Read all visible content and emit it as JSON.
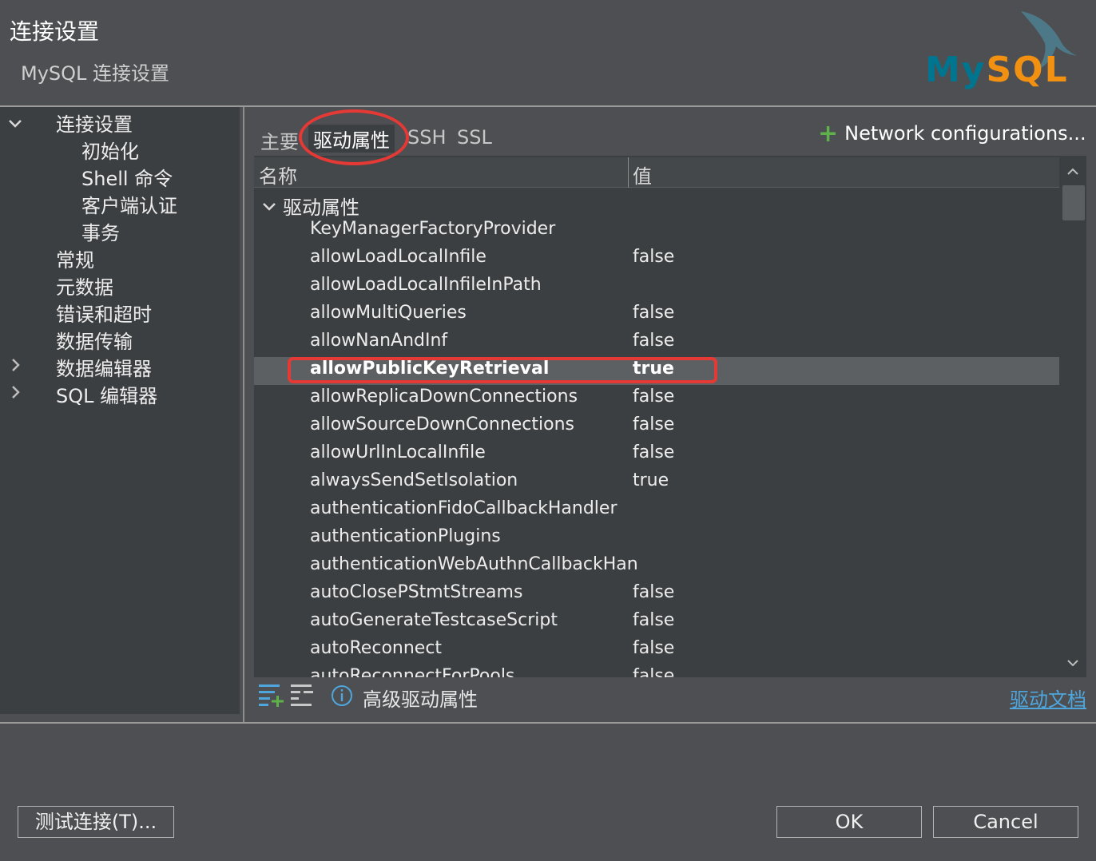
{
  "header": {
    "title": "连接设置",
    "subtitle": "MySQL 连接设置",
    "logo_part1": "My",
    "logo_part2": "SQL",
    "logo_icon": "mysql-dolphin-icon"
  },
  "sidebar": {
    "items": [
      {
        "label": "连接设置",
        "expanded": true
      },
      {
        "label": "初始化"
      },
      {
        "label": "Shell 命令"
      },
      {
        "label": "客户端认证"
      },
      {
        "label": "事务"
      },
      {
        "label": "常规"
      },
      {
        "label": "元数据"
      },
      {
        "label": "错误和超时"
      },
      {
        "label": "数据传输"
      },
      {
        "label": "数据编辑器",
        "expandable": true
      },
      {
        "label": "SQL 编辑器",
        "expandable": true
      }
    ]
  },
  "tabs": [
    {
      "label": "主要"
    },
    {
      "label": "驱动属性",
      "active": true
    },
    {
      "label": "SSH"
    },
    {
      "label": "SSL"
    }
  ],
  "network_configurations": "Network configurations...",
  "table": {
    "col_name": "名称",
    "col_value": "值",
    "group_label": "驱动属性",
    "rows": [
      {
        "name": "KeyManagerFactoryProvider",
        "value": ""
      },
      {
        "name": "allowLoadLocalInfile",
        "value": "false"
      },
      {
        "name": "allowLoadLocalInfileInPath",
        "value": ""
      },
      {
        "name": "allowMultiQueries",
        "value": "false"
      },
      {
        "name": "allowNanAndInf",
        "value": "false"
      },
      {
        "name": "allowPublicKeyRetrieval",
        "value": "true",
        "selected": true
      },
      {
        "name": "allowReplicaDownConnections",
        "value": "false"
      },
      {
        "name": "allowSourceDownConnections",
        "value": "false"
      },
      {
        "name": "allowUrlInLocalInfile",
        "value": "false"
      },
      {
        "name": "alwaysSendSetIsolation",
        "value": "true"
      },
      {
        "name": "authenticationFidoCallbackHandler",
        "value": ""
      },
      {
        "name": "authenticationPlugins",
        "value": ""
      },
      {
        "name": "authenticationWebAuthnCallbackHan",
        "value": ""
      },
      {
        "name": "autoClosePStmtStreams",
        "value": "false"
      },
      {
        "name": "autoGenerateTestcaseScript",
        "value": "false"
      },
      {
        "name": "autoReconnect",
        "value": "false"
      },
      {
        "name": "autoReconnectForPools",
        "value": "false"
      }
    ]
  },
  "bottom_bar": {
    "advanced_label": "高级驱动属性",
    "driver_doc_link": "驱动文档"
  },
  "buttons": {
    "test_connection": "测试连接(T)...",
    "ok": "OK",
    "cancel": "Cancel"
  },
  "colors": {
    "background": "#4d4f52",
    "panel": "#3c3f41",
    "selected_row": "#5d6063",
    "highlight_annotation": "#e53935",
    "link": "#4ea6dc",
    "add_icon": "#5fb14a",
    "logo_blue": "#00758f",
    "logo_orange": "#f29111"
  }
}
